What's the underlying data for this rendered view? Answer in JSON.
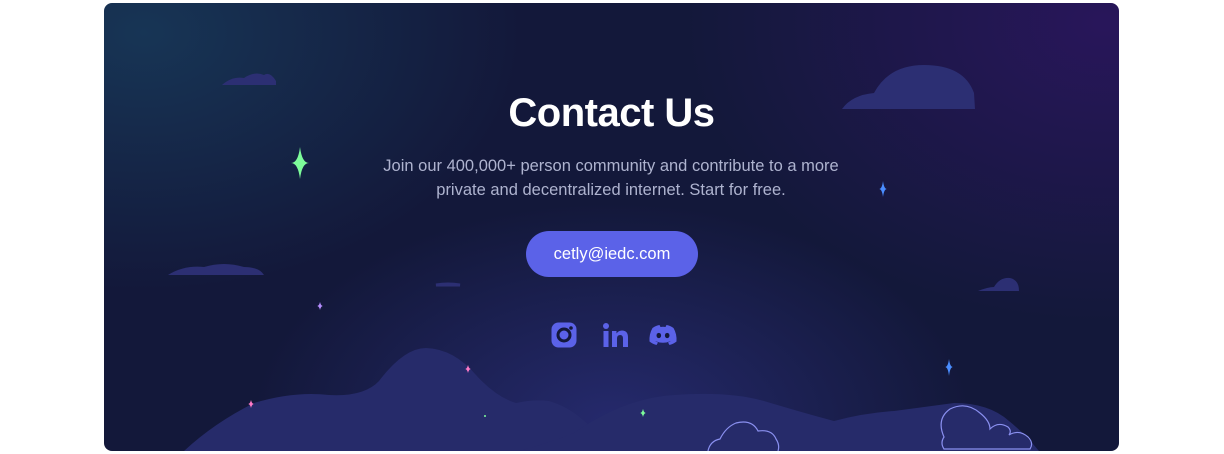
{
  "contact": {
    "title": "Contact Us",
    "subtitle": "Join our 400,000+ person community and contribute to a more private and decentralized internet. Start for free.",
    "email": "cetly@iedc.com"
  },
  "social": [
    {
      "name": "instagram",
      "icon": "instagram-icon"
    },
    {
      "name": "linkedin",
      "icon": "linkedin-icon"
    },
    {
      "name": "discord",
      "icon": "discord-icon"
    }
  ],
  "colors": {
    "background": "#13183a",
    "accent": "#5b62e8",
    "hills": "#262b6a",
    "clouds": "#2c2f73",
    "sparkle_green": "#7dfc9a",
    "sparkle_blue": "#4a8dff",
    "sparkle_pink": "#ff7ac8"
  }
}
